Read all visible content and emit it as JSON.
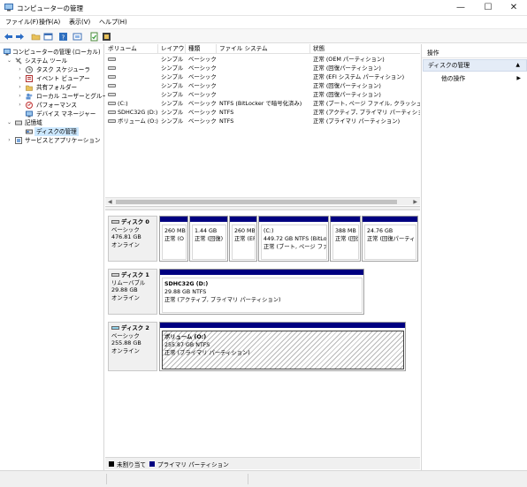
{
  "window": {
    "title": "コンピューターの管理",
    "minimize_glyph": "—",
    "maximize_glyph": "☐",
    "close_glyph": "✕"
  },
  "menu": [
    "ファイル(F)",
    "操作(A)",
    "表示(V)",
    "ヘルプ(H)"
  ],
  "toolbar_icons": [
    "back-icon",
    "forward-icon",
    "folder-icon",
    "properties-icon",
    "help-icon",
    "refresh-icon",
    "export-icon",
    "tools-icon"
  ],
  "tree": {
    "root": "コンピューターの管理 (ローカル)",
    "system_tools": "システム ツール",
    "task_scheduler": "タスク スケジューラ",
    "event_viewer": "イベント ビューアー",
    "shared_folders": "共有フォルダー",
    "local_users": "ローカル ユーザーとグループ",
    "performance": "パフォーマンス",
    "device_manager": "デバイス マネージャー",
    "storage": "記憶域",
    "disk_management": "ディスクの管理",
    "services": "サービスとアプリケーション",
    "collapse_glyph": "⌄",
    "expand_glyph": "›"
  },
  "volume_table": {
    "headers": [
      "ボリューム",
      "レイアウト",
      "種類",
      "ファイル システム",
      "状態"
    ],
    "rows": [
      {
        "volume": "",
        "layout": "シンプル",
        "type": "ベーシック",
        "fs": "",
        "status": "正常 (OEM パーティション)"
      },
      {
        "volume": "",
        "layout": "シンプル",
        "type": "ベーシック",
        "fs": "",
        "status": "正常 (回復パーティション)"
      },
      {
        "volume": "",
        "layout": "シンプル",
        "type": "ベーシック",
        "fs": "",
        "status": "正常 (EFI システム パーティション)"
      },
      {
        "volume": "",
        "layout": "シンプル",
        "type": "ベーシック",
        "fs": "",
        "status": "正常 (回復パーティション)"
      },
      {
        "volume": "",
        "layout": "シンプル",
        "type": "ベーシック",
        "fs": "",
        "status": "正常 (回復パーティション)"
      },
      {
        "volume": "(C:)",
        "layout": "シンプル",
        "type": "ベーシック",
        "fs": "NTFS (BitLocker で暗号化済み)",
        "status": "正常 (ブート, ページ ファイル, クラッシュ ダンプ"
      },
      {
        "volume": "SDHC32G (D:)",
        "layout": "シンプル",
        "type": "ベーシック",
        "fs": "NTFS",
        "status": "正常 (アクティブ, プライマリ パーティション)"
      },
      {
        "volume": "ボリューム (O:)",
        "layout": "シンプル",
        "type": "ベーシック",
        "fs": "NTFS",
        "status": "正常 (プライマリ パーティション)"
      }
    ]
  },
  "disks": [
    {
      "name": "ディスク 0",
      "type": "ベーシック",
      "size": "476.81 GB",
      "state": "オンライン",
      "partitions": [
        {
          "title": "",
          "size": "260 MB",
          "status": "正常 (O"
        },
        {
          "title": "",
          "size": "1.44 GB",
          "status": "正常 (回復)"
        },
        {
          "title": "",
          "size": "260 MB",
          "status": "正常 (EF"
        },
        {
          "title": "(C:)",
          "size": "449.72 GB NTFS (BitLoc",
          "status": "正常 (ブート, ページ ファイ"
        },
        {
          "title": "",
          "size": "388 MB",
          "status": "正常 (回復)"
        },
        {
          "title": "",
          "size": "24.76 GB",
          "status": "正常 (回復パーティ"
        }
      ]
    },
    {
      "name": "ディスク 1",
      "type": "リムーバブル",
      "size": "29.88 GB",
      "state": "オンライン",
      "partitions": [
        {
          "title": "SDHC32G  (D:)",
          "size": "29.88 GB NTFS",
          "status": "正常 (アクティブ, プライマリ パーティション)"
        }
      ]
    },
    {
      "name": "ディスク 2",
      "type": "ベーシック",
      "size": "255.88 GB",
      "state": "オンライン",
      "partitions": [
        {
          "title": "ボリューム  (O:)",
          "size": "255.87 GB NTFS",
          "status": "正常 (プライマリ パーティション)"
        }
      ]
    }
  ],
  "legend": {
    "unallocated": "未割り当て",
    "primary": "プライマリ パーティション",
    "unallocated_color": "#000000",
    "primary_color": "#000080"
  },
  "actions": {
    "header": "操作",
    "section": "ディスクの管理",
    "section_caret": "▲",
    "more": "他の操作",
    "more_caret": "▶"
  },
  "scroll": {
    "left_arrow": "◀",
    "right_arrow": "▶"
  }
}
